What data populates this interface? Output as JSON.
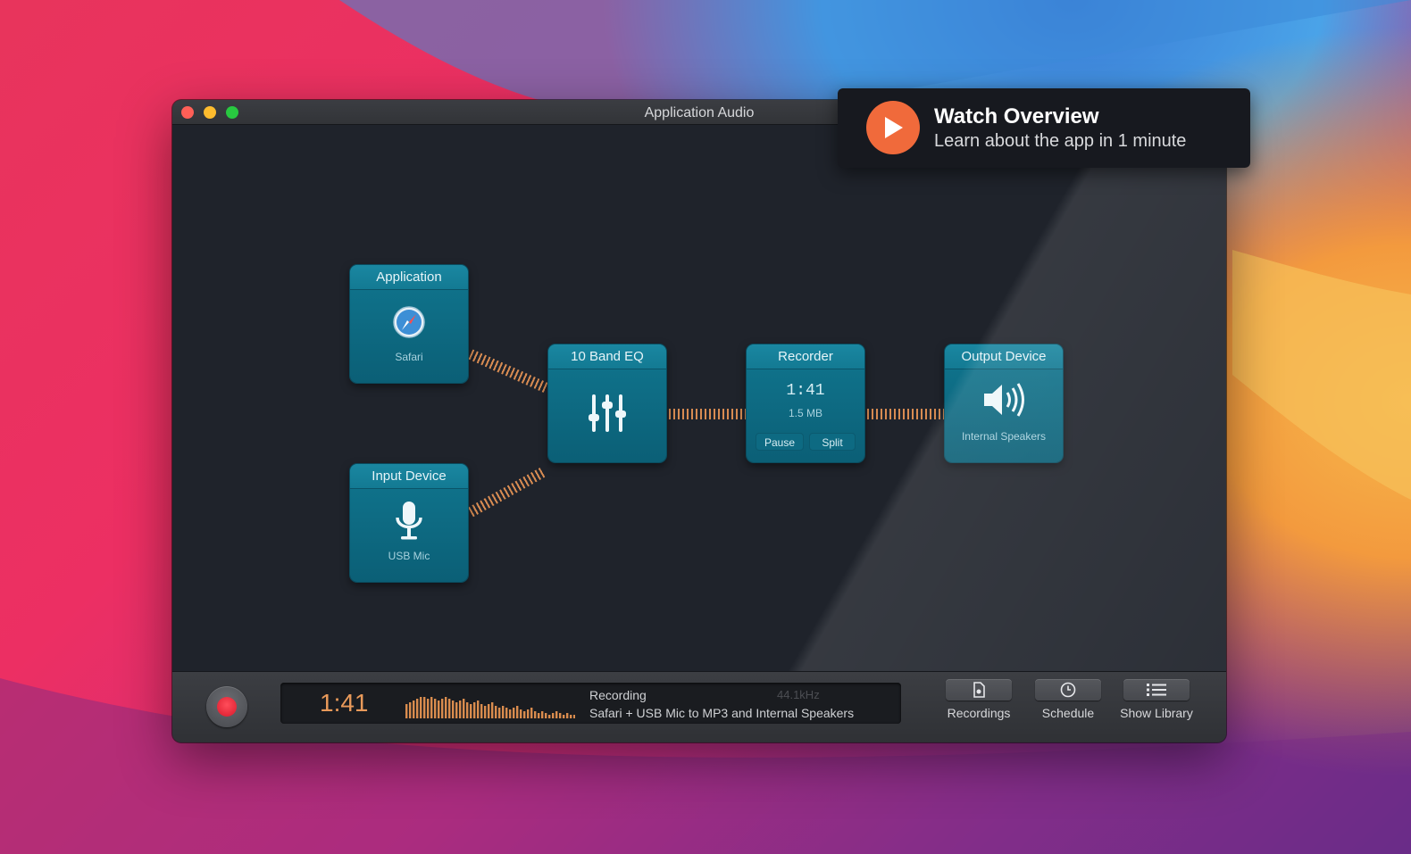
{
  "window": {
    "title": "Application Audio"
  },
  "overview": {
    "title": "Watch Overview",
    "subtitle": "Learn about the app in 1 minute",
    "icon": "play-icon",
    "accent": "#f06a3b"
  },
  "nodes": {
    "application": {
      "header": "Application",
      "label": "Safari",
      "icon": "safari-compass-icon"
    },
    "input_device": {
      "header": "Input Device",
      "label": "USB Mic",
      "icon": "microphone-icon"
    },
    "eq": {
      "header": "10 Band EQ",
      "icon": "equalizer-sliders-icon"
    },
    "recorder": {
      "header": "Recorder",
      "time": "1:41",
      "size": "1.5 MB",
      "pause_label": "Pause",
      "split_label": "Split"
    },
    "output_device": {
      "header": "Output Device",
      "label": "Internal Speakers",
      "icon": "speaker-icon"
    }
  },
  "status_bar": {
    "time": "1:41",
    "status": "Recording",
    "sample_rate": "44.1kHz",
    "detail": "Safari + USB Mic to MP3 and Internal Speakers",
    "record_color": "#e32636"
  },
  "toolbar": {
    "recordings_label": "Recordings",
    "schedule_label": "Schedule",
    "show_library_label": "Show Library"
  }
}
